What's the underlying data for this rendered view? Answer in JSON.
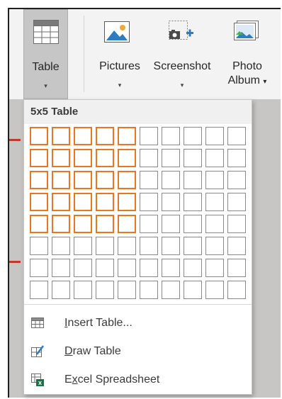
{
  "ribbon": {
    "table": {
      "label": "Table",
      "dropdown": "▾"
    },
    "pictures": {
      "label": "Pictures",
      "dropdown": "▾"
    },
    "screenshot": {
      "label": "Screenshot",
      "dropdown": "▾"
    },
    "photo_album": {
      "label_line1": "Photo",
      "label_line2": "Album",
      "dropdown": "▾"
    }
  },
  "table_menu": {
    "header": "5x5 Table",
    "grid": {
      "columns": 10,
      "rows": 8,
      "selected_columns": 5,
      "selected_rows": 5
    },
    "items": [
      {
        "icon": "insert-table-icon",
        "label": "Insert Table...",
        "access_key": "I"
      },
      {
        "icon": "draw-table-icon",
        "label": "Draw Table",
        "access_key": "D"
      },
      {
        "icon": "excel-spreadsheet-icon",
        "label": "Excel Spreadsheet",
        "access_key": "x"
      }
    ]
  },
  "colors": {
    "selection": "#e87722",
    "button_active": "#c6c6c6",
    "grid_border": "#8a8a8a"
  }
}
